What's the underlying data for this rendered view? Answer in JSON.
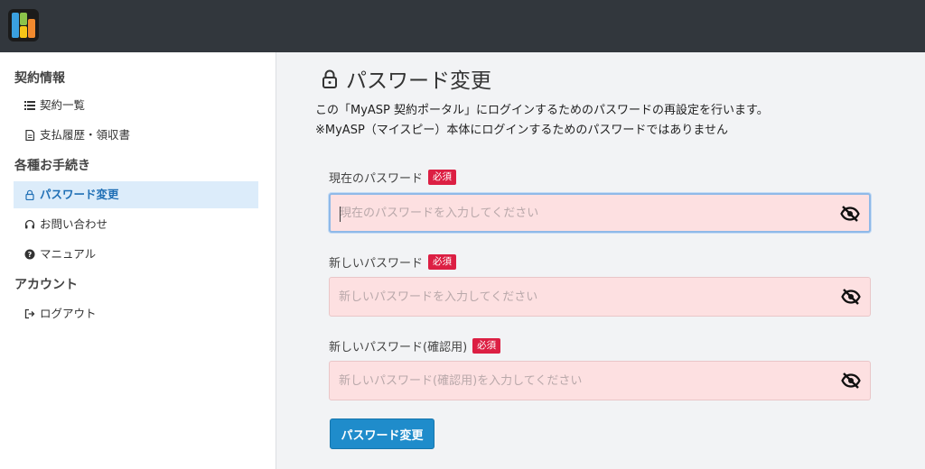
{
  "sidebar": {
    "sections": [
      {
        "heading": "契約情報",
        "items": [
          {
            "label": "契約一覧",
            "icon": "list-icon"
          },
          {
            "label": "支払履歴・領収書",
            "icon": "document-icon"
          }
        ]
      },
      {
        "heading": "各種お手続き",
        "items": [
          {
            "label": "パスワード変更",
            "icon": "lock-icon",
            "active": true
          },
          {
            "label": "お問い合わせ",
            "icon": "headset-icon"
          },
          {
            "label": "マニュアル",
            "icon": "question-icon"
          }
        ]
      },
      {
        "heading": "アカウント",
        "items": [
          {
            "label": "ログアウト",
            "icon": "logout-icon"
          }
        ]
      }
    ]
  },
  "main": {
    "title": "パスワード変更",
    "description_line1": "この「MyASP 契約ポータル」にログインするためのパスワードの再設定を行います。",
    "description_line2": "※MyASP（マイスピー）本体にログインするためのパスワードではありません",
    "required_badge": "必須",
    "fields": [
      {
        "label": "現在のパスワード",
        "placeholder": "現在のパスワードを入力してください",
        "focused": true
      },
      {
        "label": "新しいパスワード",
        "placeholder": "新しいパスワードを入力してください"
      },
      {
        "label": "新しいパスワード(確認用)",
        "placeholder": "新しいパスワード(確認用)を入力してください"
      }
    ],
    "submit_label": "パスワード変更"
  },
  "colors": {
    "topbar": "#32373d",
    "accent": "#1f8ccb",
    "badge": "#dc1f43",
    "field_bg": "#fde0e1",
    "active_bg": "#dcecfa"
  }
}
